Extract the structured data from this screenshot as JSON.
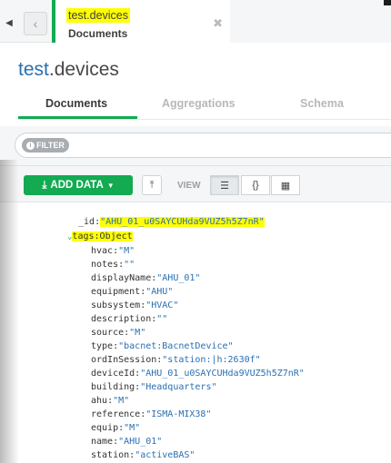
{
  "tab": {
    "namespace": "test.devices",
    "subtitle": "Documents",
    "close_glyph": "✖"
  },
  "header": {
    "db": "test",
    "collection": ".devices"
  },
  "subtabs": [
    "Documents",
    "Aggregations",
    "Schema"
  ],
  "filter": {
    "pill_label": "FILTER"
  },
  "toolbar": {
    "add_data_label": "ADD DATA",
    "view_label": "VIEW"
  },
  "document": {
    "id_key": "_id",
    "id_value": "\"AHU_01_u0SAYCUHda9VUZ5h5Z7nR\"",
    "tags_key": "tags",
    "tags_type": "Object",
    "fields": [
      {
        "key": "hvac",
        "value": "\"M\""
      },
      {
        "key": "notes",
        "value": "\"\""
      },
      {
        "key": "displayName",
        "value": "\"AHU_01\""
      },
      {
        "key": "equipment",
        "value": "\"AHU\""
      },
      {
        "key": "subsystem",
        "value": "\"HVAC\""
      },
      {
        "key": "description",
        "value": "\"\""
      },
      {
        "key": "source",
        "value": "\"M\""
      },
      {
        "key": "type",
        "value": "\"bacnet:BacnetDevice\""
      },
      {
        "key": "ordInSession",
        "value": "\"station:|h:2630f\""
      },
      {
        "key": "deviceId",
        "value": "\"AHU_01_u0SAYCUHda9VUZ5h5Z7nR\""
      },
      {
        "key": "building",
        "value": "\"Headquarters\""
      },
      {
        "key": "ahu",
        "value": "\"M\""
      },
      {
        "key": "reference",
        "value": "\"ISMA-MIX38\""
      },
      {
        "key": "equip",
        "value": "\"M\""
      },
      {
        "key": "name",
        "value": "\"AHU_01\""
      },
      {
        "key": "station",
        "value": "\"activeBAS\""
      }
    ]
  },
  "colors": {
    "accent": "#13aa52",
    "link": "#2a6fb1",
    "highlight": "#ffff00"
  }
}
